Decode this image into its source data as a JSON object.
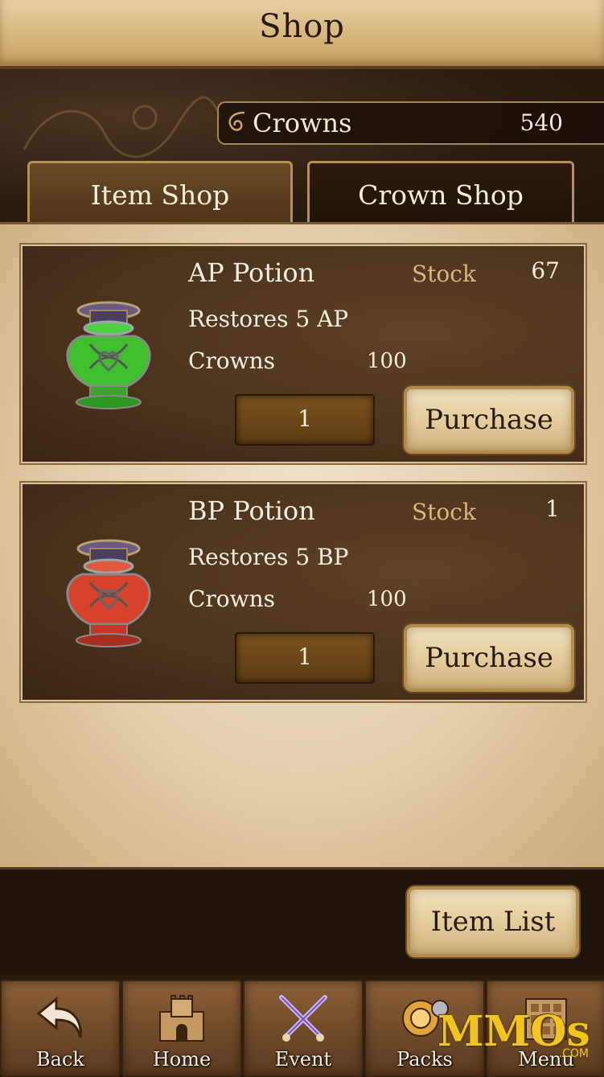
{
  "header": {
    "title": "Shop"
  },
  "currency": {
    "label": "Crowns",
    "value": "540"
  },
  "tabs": [
    {
      "label": "Item Shop",
      "active": true
    },
    {
      "label": "Crown Shop",
      "active": false
    }
  ],
  "items": [
    {
      "name": "AP Potion",
      "stock_label": "Stock",
      "stock": "67",
      "description": "Restores 5 AP",
      "price_label": "Crowns",
      "price": "100",
      "quantity": "1",
      "purchase_label": "Purchase",
      "icon": "green-potion-icon",
      "color": "#3fbf2e"
    },
    {
      "name": "BP Potion",
      "stock_label": "Stock",
      "stock": "1",
      "description": "Restores 5 BP",
      "price_label": "Crowns",
      "price": "100",
      "quantity": "1",
      "purchase_label": "Purchase",
      "icon": "red-potion-icon",
      "color": "#d8412c"
    }
  ],
  "footer": {
    "item_list_label": "Item List"
  },
  "nav": [
    {
      "label": "Back",
      "icon": "back-arrow-icon"
    },
    {
      "label": "Home",
      "icon": "castle-icon"
    },
    {
      "label": "Event",
      "icon": "crossed-swords-icon"
    },
    {
      "label": "Packs",
      "icon": "packs-icon"
    },
    {
      "label": "Menu",
      "icon": "menu-grid-icon"
    }
  ],
  "watermark": {
    "text": "MMOs",
    "sub": ".COM"
  }
}
